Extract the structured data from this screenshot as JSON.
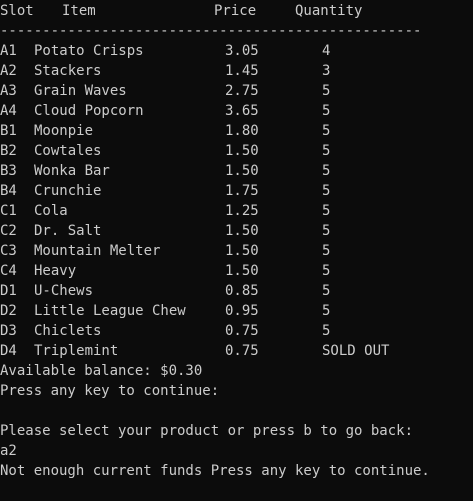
{
  "theme": {
    "background": "#0c0c0c",
    "foreground": "#cccccc"
  },
  "table": {
    "headers": {
      "slot": "Slot",
      "item": "Item",
      "price": "Price",
      "quantity": "Quantity"
    },
    "separator": "--------------------------------------------------",
    "rows": [
      {
        "slot": "A1",
        "item": "Potato Crisps",
        "price": "3.05",
        "quantity": "4"
      },
      {
        "slot": "A2",
        "item": "Stackers",
        "price": "1.45",
        "quantity": "3"
      },
      {
        "slot": "A3",
        "item": "Grain Waves",
        "price": "2.75",
        "quantity": "5"
      },
      {
        "slot": "A4",
        "item": "Cloud Popcorn",
        "price": "3.65",
        "quantity": "5"
      },
      {
        "slot": "B1",
        "item": "Moonpie",
        "price": "1.80",
        "quantity": "5"
      },
      {
        "slot": "B2",
        "item": "Cowtales",
        "price": "1.50",
        "quantity": "5"
      },
      {
        "slot": "B3",
        "item": "Wonka Bar",
        "price": "1.50",
        "quantity": "5"
      },
      {
        "slot": "B4",
        "item": "Crunchie",
        "price": "1.75",
        "quantity": "5"
      },
      {
        "slot": "C1",
        "item": "Cola",
        "price": "1.25",
        "quantity": "5"
      },
      {
        "slot": "C2",
        "item": "Dr. Salt",
        "price": "1.50",
        "quantity": "5"
      },
      {
        "slot": "C3",
        "item": "Mountain Melter",
        "price": "1.50",
        "quantity": "5"
      },
      {
        "slot": "C4",
        "item": "Heavy",
        "price": "1.50",
        "quantity": "5"
      },
      {
        "slot": "D1",
        "item": "U-Chews",
        "price": "0.85",
        "quantity": "5"
      },
      {
        "slot": "D2",
        "item": "Little League Chew",
        "price": "0.95",
        "quantity": "5"
      },
      {
        "slot": "D3",
        "item": "Chiclets",
        "price": "0.75",
        "quantity": "5"
      },
      {
        "slot": "D4",
        "item": "Triplemint",
        "price": "0.75",
        "quantity": "SOLD OUT"
      }
    ]
  },
  "output": {
    "balance": "Available balance: $0.30",
    "press_continue": "Press any key to continue:",
    "prompt": "Please select your product or press b to go back:",
    "user_input": "a2",
    "error": "Not enough current funds Press any key to continue."
  }
}
